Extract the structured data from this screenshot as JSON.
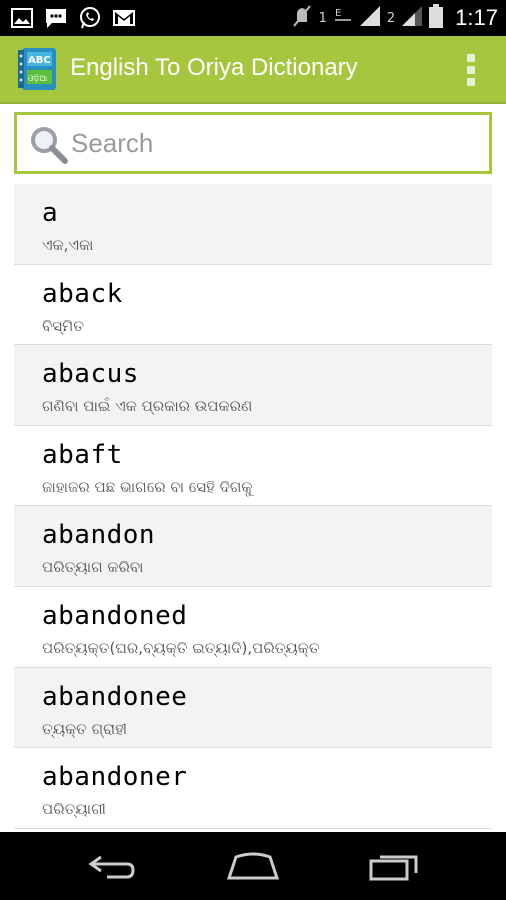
{
  "status_bar": {
    "left_icons": [
      "image-icon",
      "chat-icon",
      "whatsapp-icon",
      "gmail-icon"
    ],
    "sim1": "1",
    "sim2": "2",
    "time": "1:17"
  },
  "action_bar": {
    "logo_text_top": "ABC",
    "logo_text_bottom": "ଓଡ଼ିଆ",
    "title": "English To Oriya Dictionary",
    "color": "#a6c63f"
  },
  "search": {
    "placeholder": "Search",
    "value": ""
  },
  "words": [
    {
      "word": "a",
      "meaning": "ଏକ,ଏକା"
    },
    {
      "word": "aback",
      "meaning": "ବିସ୍ମିତ"
    },
    {
      "word": "abacus",
      "meaning": "ଗଣିବା ପାଇଁ ଏକ ପ୍ରକାର ଉପକରଣ"
    },
    {
      "word": "abaft",
      "meaning": "ଜାହାଜର ପଛ ଭାଗରେ ବା ସେହି ଦିଗକୁ"
    },
    {
      "word": "abandon",
      "meaning": "ପରିତ୍ୟାଗ କରିବା"
    },
    {
      "word": "abandoned",
      "meaning": "ପରିତ୍ୟକ୍ତ(ଘର,ବ୍ୟକ୍ତି ଇତ୍ୟାଦି),ପରିତ୍ୟକ୍ତ"
    },
    {
      "word": "abandonee",
      "meaning": "ତ୍ୟକ୍ତ ଗ୍ରାହୀ"
    },
    {
      "word": "abandoner",
      "meaning": "ପରିତ୍ୟାଗୀ"
    }
  ],
  "navigation": {
    "buttons": [
      "back-icon",
      "home-icon",
      "recent-apps-icon"
    ]
  }
}
